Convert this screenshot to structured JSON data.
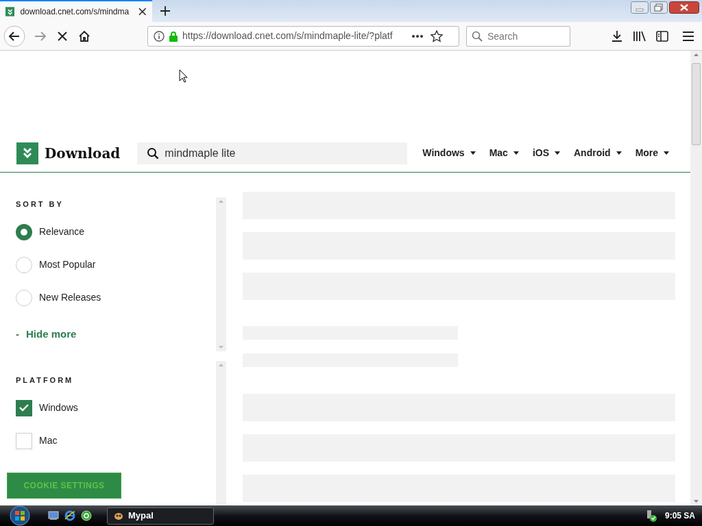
{
  "browser": {
    "tab": {
      "title": "download.cnet.com/s/mindma",
      "selected": true
    },
    "address": "https://download.cnet.com/s/mindmaple-lite/?platf",
    "search": {
      "placeholder": "Search"
    }
  },
  "site": {
    "logo": "Download",
    "search": {
      "value": "mindmaple lite"
    },
    "nav": [
      "Windows",
      "Mac",
      "iOS",
      "Android",
      "More"
    ]
  },
  "sort_by": {
    "heading": "SORT BY",
    "options": [
      {
        "label": "Relevance",
        "selected": true
      },
      {
        "label": "Most Popular",
        "selected": false
      },
      {
        "label": "New Releases",
        "selected": false
      }
    ],
    "toggle": {
      "sign": "-",
      "label": "Hide more"
    }
  },
  "platform": {
    "heading": "PLATFORM",
    "options": [
      {
        "label": "Windows",
        "checked": true
      },
      {
        "label": "Mac",
        "checked": false
      }
    ]
  },
  "cookie_button": "COOKIE SETTINGS",
  "taskbar": {
    "window": "Mypal",
    "clock": "9:05 SA"
  }
}
